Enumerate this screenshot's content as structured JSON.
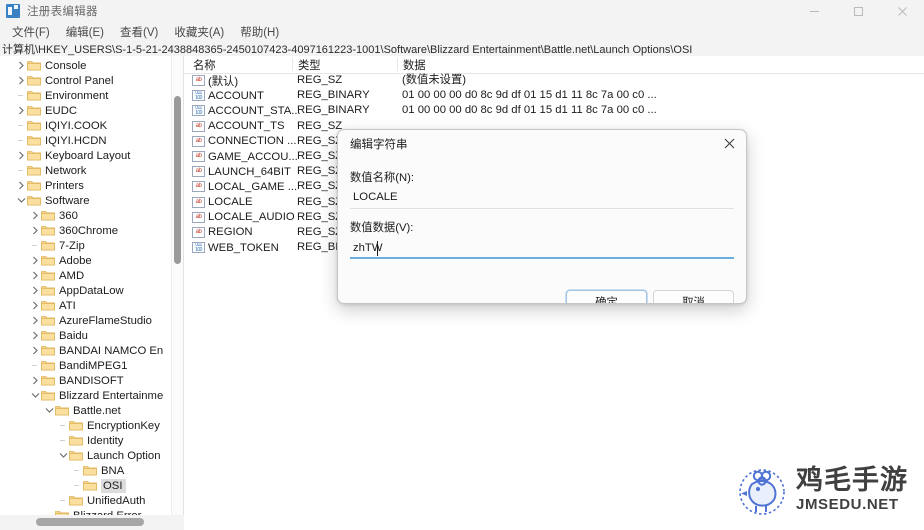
{
  "window": {
    "title": "注册表编辑器",
    "icon": "registry-editor-icon",
    "minimize_label": "—",
    "maximize_label": "▢",
    "close_label": "✕"
  },
  "menu": {
    "items": [
      {
        "label": "文件(F)"
      },
      {
        "label": "编辑(E)"
      },
      {
        "label": "查看(V)"
      },
      {
        "label": "收藏夹(A)"
      },
      {
        "label": "帮助(H)"
      }
    ]
  },
  "address": {
    "path": "计算机\\HKEY_USERS\\S-1-5-21-2438848365-2450107423-4097161223-1001\\Software\\Blizzard Entertainment\\Battle.net\\Launch Options\\OSI"
  },
  "tree": {
    "items": [
      {
        "label": "Console",
        "indent": 1,
        "twist": "collapsed",
        "selected": false
      },
      {
        "label": "Control Panel",
        "indent": 1,
        "twist": "collapsed",
        "selected": false
      },
      {
        "label": "Environment",
        "indent": 1,
        "twist": "none",
        "selected": false
      },
      {
        "label": "EUDC",
        "indent": 1,
        "twist": "collapsed",
        "selected": false
      },
      {
        "label": "IQIYI.COOK",
        "indent": 1,
        "twist": "none",
        "selected": false
      },
      {
        "label": "IQIYI.HCDN",
        "indent": 1,
        "twist": "none",
        "selected": false
      },
      {
        "label": "Keyboard Layout",
        "indent": 1,
        "twist": "collapsed",
        "selected": false
      },
      {
        "label": "Network",
        "indent": 1,
        "twist": "none",
        "selected": false
      },
      {
        "label": "Printers",
        "indent": 1,
        "twist": "collapsed",
        "selected": false
      },
      {
        "label": "Software",
        "indent": 1,
        "twist": "expanded",
        "selected": false
      },
      {
        "label": "360",
        "indent": 2,
        "twist": "collapsed",
        "selected": false
      },
      {
        "label": "360Chrome",
        "indent": 2,
        "twist": "collapsed",
        "selected": false
      },
      {
        "label": "7-Zip",
        "indent": 2,
        "twist": "none",
        "selected": false
      },
      {
        "label": "Adobe",
        "indent": 2,
        "twist": "collapsed",
        "selected": false
      },
      {
        "label": "AMD",
        "indent": 2,
        "twist": "collapsed",
        "selected": false
      },
      {
        "label": "AppDataLow",
        "indent": 2,
        "twist": "collapsed",
        "selected": false
      },
      {
        "label": "ATI",
        "indent": 2,
        "twist": "collapsed",
        "selected": false
      },
      {
        "label": "AzureFlameStudio",
        "indent": 2,
        "twist": "collapsed",
        "selected": false
      },
      {
        "label": "Baidu",
        "indent": 2,
        "twist": "collapsed",
        "selected": false
      },
      {
        "label": "BANDAI NAMCO En",
        "indent": 2,
        "twist": "collapsed",
        "selected": false
      },
      {
        "label": "BandiMPEG1",
        "indent": 2,
        "twist": "none",
        "selected": false
      },
      {
        "label": "BANDISOFT",
        "indent": 2,
        "twist": "collapsed",
        "selected": false
      },
      {
        "label": "Blizzard Entertainme",
        "indent": 2,
        "twist": "expanded",
        "selected": false
      },
      {
        "label": "Battle.net",
        "indent": 3,
        "twist": "expanded",
        "selected": false
      },
      {
        "label": "EncryptionKey",
        "indent": 4,
        "twist": "none",
        "selected": false
      },
      {
        "label": "Identity",
        "indent": 4,
        "twist": "none",
        "selected": false
      },
      {
        "label": "Launch Option",
        "indent": 4,
        "twist": "expanded",
        "selected": false
      },
      {
        "label": "BNA",
        "indent": 5,
        "twist": "none",
        "selected": false
      },
      {
        "label": "OSI",
        "indent": 5,
        "twist": "none",
        "selected": true
      },
      {
        "label": "UnifiedAuth",
        "indent": 4,
        "twist": "none",
        "selected": false
      },
      {
        "label": "Blizzard Error",
        "indent": 3,
        "twist": "none",
        "selected": false
      }
    ]
  },
  "list": {
    "columns": [
      {
        "label": "名称"
      },
      {
        "label": "类型"
      },
      {
        "label": "数据"
      }
    ],
    "rows": [
      {
        "icon": "string-value-icon",
        "name": "(默认)",
        "type": "REG_SZ",
        "data": "(数值未设置)"
      },
      {
        "icon": "binary-value-icon",
        "name": "ACCOUNT",
        "type": "REG_BINARY",
        "data": "01 00 00 00 d0 8c 9d df 01 15 d1 11 8c 7a 00 c0 ..."
      },
      {
        "icon": "binary-value-icon",
        "name": "ACCOUNT_STA...",
        "type": "REG_BINARY",
        "data": "01 00 00 00 d0 8c 9d df 01 15 d1 11 8c 7a 00 c0 ..."
      },
      {
        "icon": "string-value-icon",
        "name": "ACCOUNT_TS",
        "type": "REG_SZ",
        "data": ""
      },
      {
        "icon": "string-value-icon",
        "name": "CONNECTION ...",
        "type": "REG_SZ",
        "data": ""
      },
      {
        "icon": "string-value-icon",
        "name": "GAME_ACCOU...",
        "type": "REG_SZ",
        "data": ""
      },
      {
        "icon": "string-value-icon",
        "name": "LAUNCH_64BIT",
        "type": "REG_SZ",
        "data": ""
      },
      {
        "icon": "string-value-icon",
        "name": "LOCAL_GAME ...",
        "type": "REG_SZ",
        "data": ""
      },
      {
        "icon": "string-value-icon",
        "name": "LOCALE",
        "type": "REG_SZ",
        "data": ""
      },
      {
        "icon": "string-value-icon",
        "name": "LOCALE_AUDIO",
        "type": "REG_SZ",
        "data": ""
      },
      {
        "icon": "string-value-icon",
        "name": "REGION",
        "type": "REG_SZ",
        "data": ""
      },
      {
        "icon": "binary-value-icon",
        "name": "WEB_TOKEN",
        "type": "REG_BIN",
        "data": ""
      }
    ]
  },
  "dialog": {
    "title": "编辑字符串",
    "close_icon": "close-icon",
    "name_label": "数值名称(N):",
    "name_value": "LOCALE",
    "data_label": "数值数据(V):",
    "data_value": "zhTW",
    "ok_label": "确定",
    "cancel_label": "取消",
    "accent_color": "#6aaee0"
  },
  "watermark": {
    "cn": "鸡毛手游",
    "en": "JMSEDU.NET",
    "ring_text": "WWW.JMSEDU.NET",
    "color": "#4a6fd4"
  }
}
